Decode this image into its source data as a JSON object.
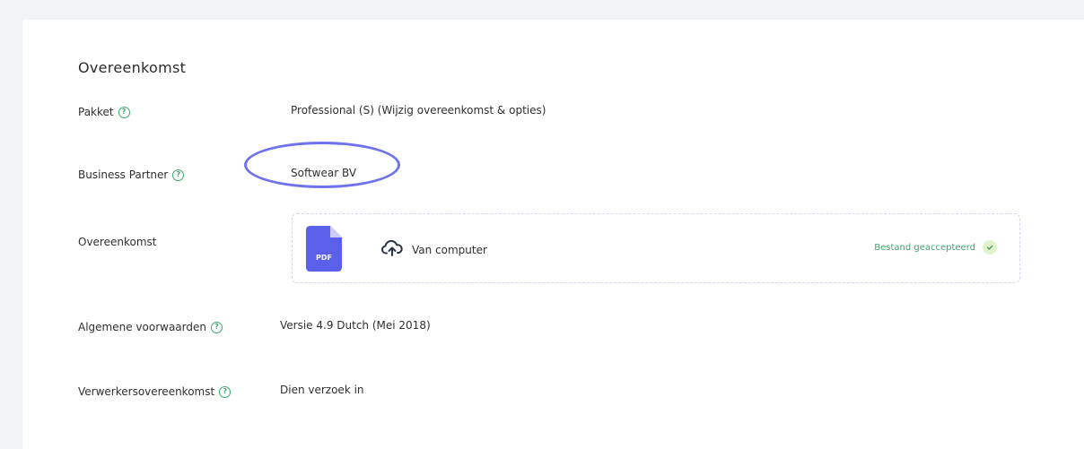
{
  "section": {
    "title": "Overeenkomst"
  },
  "rows": {
    "package": {
      "label": "Pakket",
      "value": "Professional (S) (Wijzig overeenkomst & opties)"
    },
    "business_partner": {
      "label": "Business Partner",
      "value": "Softwear BV"
    },
    "agreement": {
      "label": "Overeenkomst",
      "file_type": "PDF",
      "upload_label": "Van computer",
      "status": "Bestand geaccepteerd"
    },
    "terms": {
      "label": "Algemene voorwaarden",
      "value": "Versie 4.9 Dutch (Mei 2018)"
    },
    "processing": {
      "label": "Verwerkersovereenkomst",
      "value": "Dien verzoek in"
    }
  },
  "icons": {
    "help": "question-circle-icon",
    "upload": "cloud-upload-icon",
    "status": "check-circle-icon",
    "file": "pdf-file-icon"
  },
  "colors": {
    "accent_green": "#3aa66b",
    "pdf_blue": "#5b60ea",
    "highlight_ring": "#6d73ec",
    "status_check_bg": "#e1f3c9"
  }
}
